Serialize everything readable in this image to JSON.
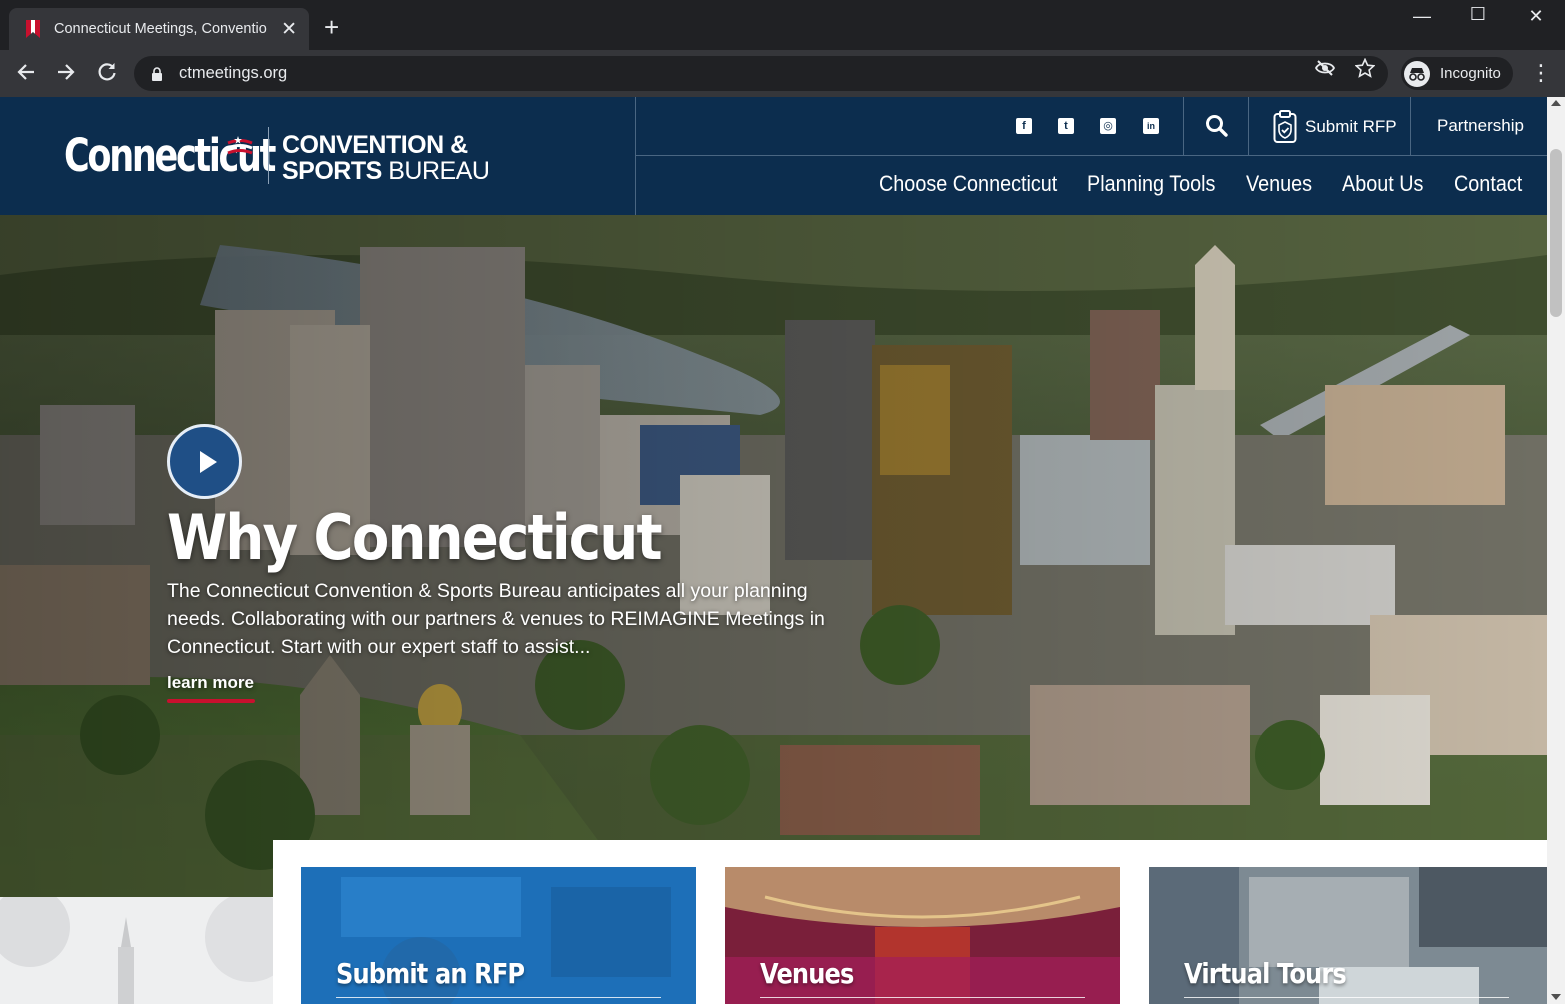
{
  "browser": {
    "tab_title": "Connecticut Meetings, Conventio",
    "new_tab": "+",
    "url": "ctmeetings.org",
    "profile_label": "Incognito"
  },
  "site": {
    "logo": {
      "wordmark": "Connecticut",
      "line1": "CONVENTION &",
      "line2_bold": "SPORTS ",
      "line2_light": "BUREAU"
    },
    "utility": {
      "social": [
        {
          "icon": "facebook-icon",
          "glyph": "f"
        },
        {
          "icon": "twitter-icon",
          "glyph": "t"
        },
        {
          "icon": "instagram-icon",
          "glyph": "◎"
        },
        {
          "icon": "linkedin-icon",
          "glyph": "in"
        }
      ],
      "submit_rfp": "Submit RFP",
      "partnership": "Partnership"
    },
    "nav": [
      "Choose Connecticut",
      "Planning Tools",
      "Venues",
      "About Us",
      "Contact"
    ],
    "colors": {
      "header_bg": "#0c2d4e",
      "accent_red": "#c8102e",
      "play_blue": "#1f4f86"
    }
  },
  "hero": {
    "title": "Why Connecticut",
    "body": "The Connecticut Convention & Sports Bureau anticipates all your planning needs. Collaborating with our partners & venues to REIMAGINE Meetings in Connecticut. Start with our expert staff to assist...",
    "cta": "learn more"
  },
  "cards": [
    {
      "label": "Submit an RFP"
    },
    {
      "label": "Venues"
    },
    {
      "label": "Virtual Tours"
    }
  ]
}
